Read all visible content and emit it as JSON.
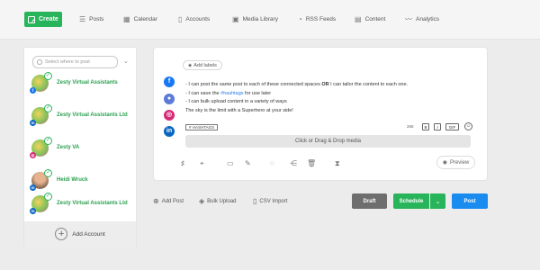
{
  "nav": {
    "create_label": "Create",
    "items": [
      {
        "label": "Posts",
        "icon": "list-icon"
      },
      {
        "label": "Calendar",
        "icon": "calendar-icon"
      },
      {
        "label": "Accounts",
        "icon": "accounts-icon"
      },
      {
        "label": "Media Library",
        "icon": "image-icon"
      },
      {
        "label": "RSS Feeds",
        "icon": "rss-icon"
      },
      {
        "label": "Content",
        "icon": "document-icon"
      },
      {
        "label": "Analytics",
        "icon": "chart-icon"
      }
    ]
  },
  "accounts_panel": {
    "selector_placeholder": "Select where to post",
    "accounts": [
      {
        "name": "Zesty Virtual Assistants",
        "network": "facebook"
      },
      {
        "name": "Zesty Virtual Assistants Ltd",
        "network": "linkedin"
      },
      {
        "name": "Zesty VA",
        "network": "instagram"
      },
      {
        "name": "Heidi Wruck",
        "network": "linkedin"
      },
      {
        "name": "Zesty Virtual Assistants Ltd",
        "network": "linkedin"
      }
    ],
    "add_account_label": "Add Account"
  },
  "composer": {
    "add_labels": "Add labels",
    "lines": [
      {
        "pre": "- I can post the same post to each of these connected spaces ",
        "bold": "OR",
        "post": " I can tailor the content to each one."
      },
      {
        "pre": "- I can save the ",
        "tag": "#hashtags",
        "post": " for use later"
      },
      {
        "pre": "- I can bulk upload content in a variety of ways"
      },
      {
        "pre": "The sky is the limit with a Superhero at your side!"
      }
    ],
    "hashtags_button": "# HASHTAGS",
    "char_count": "266",
    "format_bold": "B",
    "format_italic": "I",
    "format_gif": "GIF",
    "dropzone": "Click or Drag & Drop media",
    "preview": "Preview"
  },
  "actions": {
    "add_post": "Add Post",
    "bulk_upload": "Bulk Upload",
    "csv_import": "CSV Import",
    "draft": "Draft",
    "schedule": "Schedule",
    "post": "Post"
  },
  "colors": {
    "green": "#28b45a",
    "blue": "#1a8cf0",
    "grey": "#6e6e6e",
    "facebook": "#1877f2",
    "linkedin": "#0a66c2",
    "instagram": "#d62976"
  }
}
